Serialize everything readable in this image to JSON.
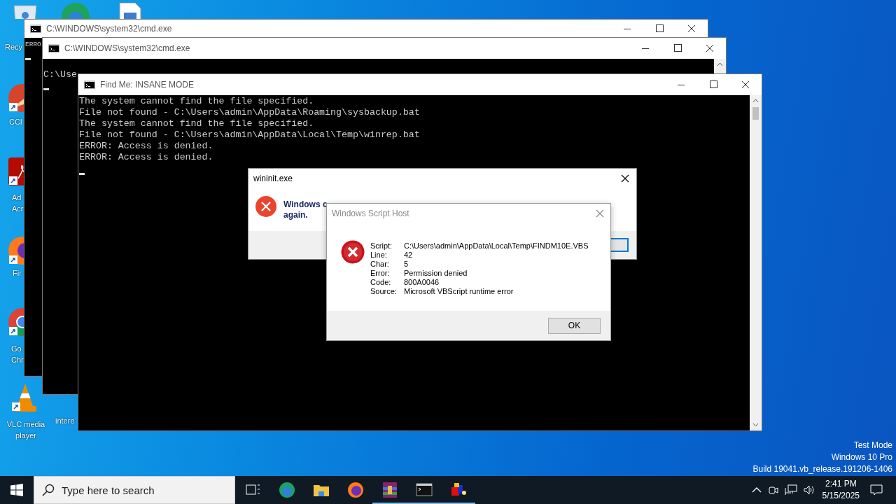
{
  "desktop_icons": [
    {
      "kind": "recycle-bin",
      "label": "Recy"
    },
    {
      "kind": "edge"
    },
    {
      "kind": "document"
    },
    {
      "kind": "ccleaner",
      "label": "CCl"
    },
    {
      "kind": "acrobat",
      "label": "Ad Acr"
    },
    {
      "kind": "firefox",
      "label": "Fir"
    },
    {
      "kind": "chrome",
      "label": "Go Chr"
    },
    {
      "kind": "vlc",
      "label": "VLC media player"
    },
    {
      "kind": "hidden",
      "label": "intere"
    }
  ],
  "windows": [
    {
      "title": "C:\\WINDOWS\\system32\\cmd.exe",
      "lines": [
        "ERRO"
      ]
    },
    {
      "title": "C:\\WINDOWS\\system32\\cmd.exe",
      "lines": [
        "C:\\Use"
      ]
    },
    {
      "title": "Find Me: INSANE MODE",
      "lines": [
        "The system cannot find the file specified.",
        "File not found - C:\\Users\\admin\\AppData\\Roaming\\sysbackup.bat",
        "The system cannot find the file specified.",
        "File not found - C:\\Users\\admin\\AppData\\Local\\Temp\\winrep.bat",
        "ERROR: Access is denied.",
        "ERROR: Access is denied."
      ]
    }
  ],
  "wininit_dialog": {
    "title": "wininit.exe",
    "message_lines": [
      "Windows c",
      "again."
    ]
  },
  "script_host_dialog": {
    "title": "Windows Script Host",
    "fields": [
      {
        "label": "Script:",
        "value": "C:\\Users\\admin\\AppData\\Local\\Temp\\FINDM10E.VBS"
      },
      {
        "label": "Line:",
        "value": "42"
      },
      {
        "label": "Char:",
        "value": "5"
      },
      {
        "label": "Error:",
        "value": "Permission denied"
      },
      {
        "label": "Code:",
        "value": "800A0046"
      },
      {
        "label": "Source:",
        "value": "Microsoft VBScript runtime error"
      }
    ],
    "button": "OK"
  },
  "system_info": [
    "Test Mode",
    "Windows 10 Pro",
    "Build 19041.vb_release.191206-1406"
  ],
  "taskbar": {
    "search": {
      "placeholder": "Type here to search"
    },
    "apps": [
      {
        "kind": "task-view",
        "running": false
      },
      {
        "kind": "edge",
        "running": false
      },
      {
        "kind": "explorer",
        "running": false
      },
      {
        "kind": "firefox",
        "running": false
      },
      {
        "kind": "winrar",
        "running": true
      },
      {
        "kind": "cmd",
        "running": true
      },
      {
        "kind": "paint-app",
        "running": true
      }
    ],
    "clock": {
      "time": "2:41 PM",
      "date": "5/15/2025"
    }
  }
}
